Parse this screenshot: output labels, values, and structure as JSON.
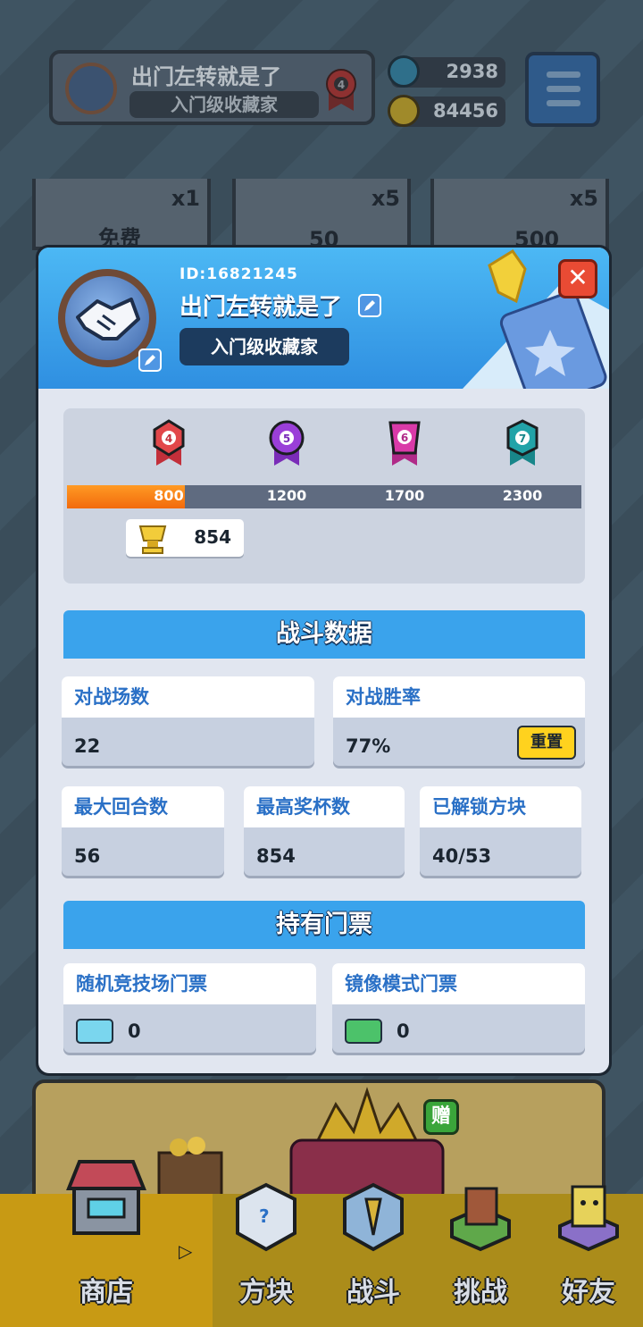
{
  "topbar": {
    "player_name": "出门左转就是了",
    "player_title": "入门级收藏家",
    "rank_level": "4",
    "gems": "2938",
    "coins": "84456"
  },
  "shop_cards": [
    {
      "qty": "x1",
      "price": "免费"
    },
    {
      "qty": "x5",
      "price": "50"
    },
    {
      "qty": "x5",
      "price": "500"
    }
  ],
  "profile": {
    "id_text": "ID:16821245",
    "name": "出门左转就是了",
    "title": "入门级收藏家",
    "close_label": "✕"
  },
  "rank_track": {
    "ranks": [
      {
        "level": "4",
        "threshold": "800",
        "color": "#e2474a"
      },
      {
        "level": "5",
        "threshold": "1200",
        "color": "#9a3fd8"
      },
      {
        "level": "6",
        "threshold": "1700",
        "color": "#d93aa8"
      },
      {
        "level": "7",
        "threshold": "2300",
        "color": "#22a3a8"
      }
    ],
    "progress_fraction": 0.23,
    "trophies": "854"
  },
  "battle_stats": {
    "header": "战斗数据",
    "matches_label": "对战场数",
    "matches_value": "22",
    "winrate_label": "对战胜率",
    "winrate_value": "77%",
    "reset_label": "重置",
    "max_rounds_label": "最大回合数",
    "max_rounds_value": "56",
    "max_trophies_label": "最高奖杯数",
    "max_trophies_value": "854",
    "unlocked_label": "已解锁方块",
    "unlocked_value": "40/53"
  },
  "tickets": {
    "header": "持有门票",
    "random_arena_label": "随机竞技场门票",
    "random_arena_value": "0",
    "mirror_label": "镜像模式门票",
    "mirror_value": "0"
  },
  "promo": {
    "gift_tag": "赠"
  },
  "nav": {
    "items": [
      {
        "label": "商店"
      },
      {
        "label": "方块"
      },
      {
        "label": "战斗"
      },
      {
        "label": "挑战"
      },
      {
        "label": "好友"
      }
    ]
  }
}
